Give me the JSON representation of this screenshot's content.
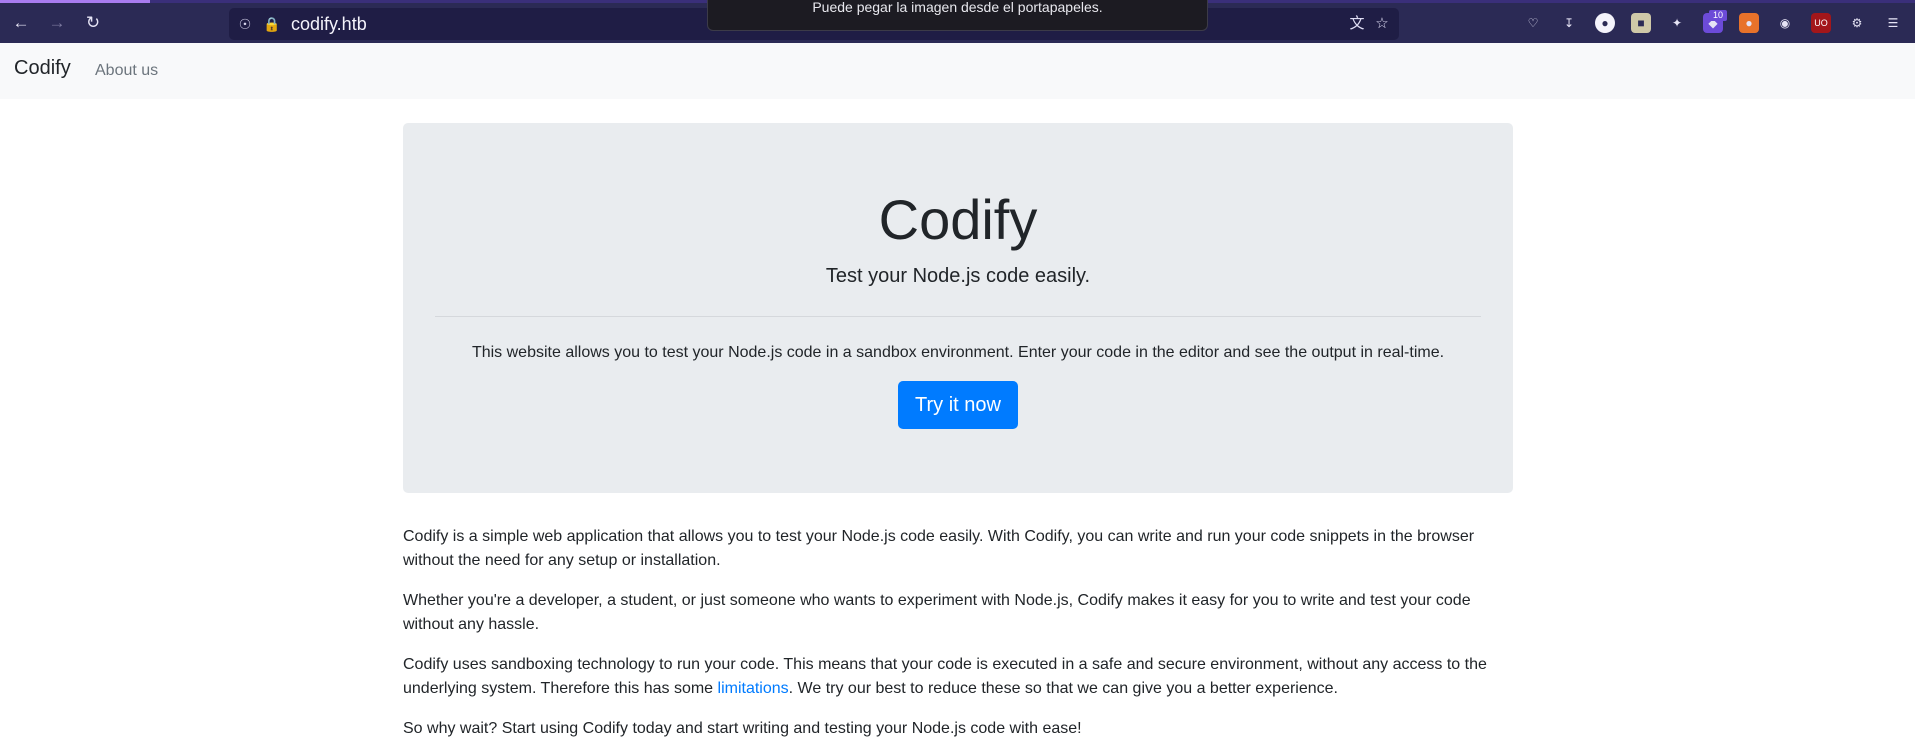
{
  "browser": {
    "url": "codify.htb",
    "toast": "Puede pegar la imagen desde el portapapeles.",
    "ext_badge": "10",
    "icons": {
      "back": "arrow-left-icon",
      "forward": "arrow-right-icon",
      "reload": "reload-icon",
      "shield": "shield-icon",
      "lock": "lock-icon",
      "translate": "translate-icon",
      "bookmark": "star-icon"
    }
  },
  "navbar": {
    "brand": "Codify",
    "about": "About us"
  },
  "hero": {
    "title": "Codify",
    "lead": "Test your Node.js code easily.",
    "description": "This website allows you to test your Node.js code in a sandbox environment. Enter your code in the editor and see the output in real-time.",
    "cta": "Try it now"
  },
  "paragraphs": {
    "p1": "Codify is a simple web application that allows you to test your Node.js code easily. With Codify, you can write and run your code snippets in the browser without the need for any setup or installation.",
    "p2": "Whether you're a developer, a student, or just someone who wants to experiment with Node.js, Codify makes it easy for you to write and test your code without any hassle.",
    "p3_before": "Codify uses sandboxing technology to run your code. This means that your code is executed in a safe and secure environment, without any access to the underlying system. Therefore this has some ",
    "p3_link": "limitations",
    "p3_after": ". We try our best to reduce these so that we can give you a better experience.",
    "p4": "So why wait? Start using Codify today and start writing and testing your Node.js code with ease!"
  },
  "colors": {
    "primary": "#007bff",
    "chrome": "#2b2a55",
    "jumbotron": "#e9ecef"
  }
}
